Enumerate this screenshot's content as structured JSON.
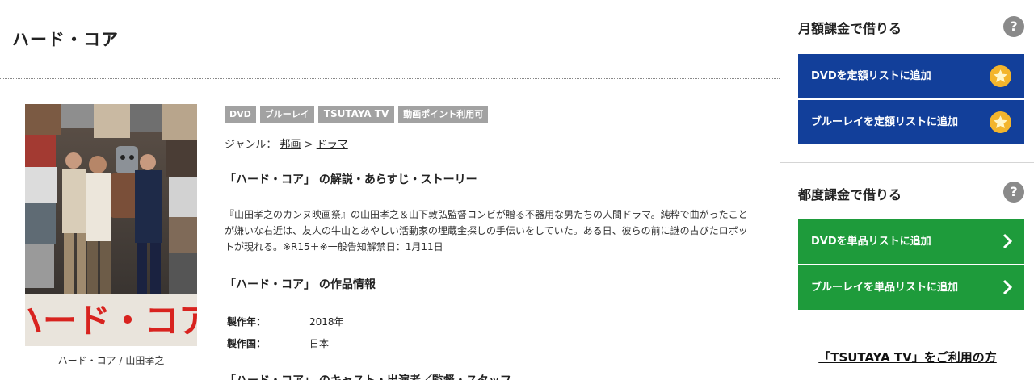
{
  "title": "ハード・コア",
  "poster": {
    "caption": "ハード・コア / 山田孝之",
    "poster_title": "ハード・コア",
    "icon": "movie-poster"
  },
  "tags": [
    "DVD",
    "ブルーレイ",
    "TSUTAYA TV",
    "動画ポイント利用可"
  ],
  "genre": {
    "label": "ジャンル：",
    "items": [
      "邦画",
      "ドラマ"
    ],
    "separator": ">"
  },
  "sections": {
    "synopsis_heading": "「ハード・コア」 の解説・あらすじ・ストーリー",
    "synopsis": "『山田孝之のカンヌ映画祭』の山田孝之＆山下敦弘監督コンビが贈る不器用な男たちの人間ドラマ。純粋で曲がったことが嫌いな右近は、友人の牛山とあやしい活動家の埋蔵金探しの手伝いをしていた。ある日、彼らの前に謎の古びたロボットが現れる。※R15＋※一般告知解禁日：1月11日",
    "info_heading": "「ハード・コア」 の作品情報",
    "info": [
      {
        "key": "製作年：",
        "value": "2018年"
      },
      {
        "key": "製作国：",
        "value": "日本"
      }
    ],
    "cast_heading": "「ハード・コア」 のキャスト・出演者／監督・スタッフ"
  },
  "sidebar": {
    "monthly": {
      "heading": "月額課金で借りる",
      "help": "?",
      "buttons": [
        "DVDを定額リストに追加",
        "ブルーレイを定額リストに追加"
      ]
    },
    "single": {
      "heading": "都度課金で借りる",
      "help": "?",
      "buttons": [
        "DVDを単品リストに追加",
        "ブルーレイを単品リストに追加"
      ]
    },
    "tv_link": "「TSUTAYA TV」をご利用の方"
  },
  "colors": {
    "blue_button": "#123f9a",
    "green_button": "#1e9b3b",
    "tag_gray": "#a2a2a2",
    "star": "#f3b52c",
    "poster_red": "#d8231f"
  }
}
